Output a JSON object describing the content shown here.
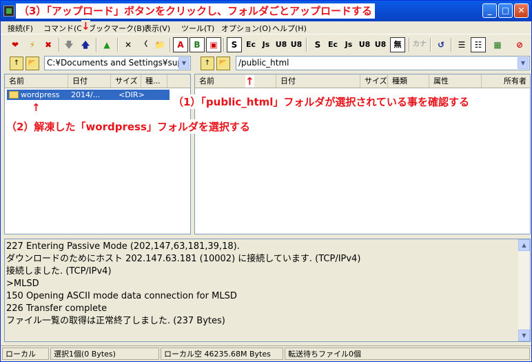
{
  "title_annotation": "（3）「アップロード」ボタンをクリックし、フォルダごとアップロードする",
  "window_buttons": {
    "minimize": "_",
    "maximize": "□",
    "close": "✕"
  },
  "menu": [
    "接続(F)",
    "コマンド(C)",
    "ブックマーク(B)",
    "表示(V)",
    "ツール(T)",
    "オプション(O)",
    "ヘルプ(H)"
  ],
  "toolbar": {
    "icons": [
      "connect-icon",
      "quick-connect-icon",
      "disconnect-icon",
      "download-icon",
      "upload-icon",
      "mirror-upload-icon",
      "delete-icon",
      "rename-icon",
      "new-folder-icon",
      "ascii-mode-icon",
      "binary-mode-icon",
      "auto-mode-icon",
      "sjis-icon",
      "euc-icon",
      "jis-icon",
      "utf8-icon",
      "utf8n-icon",
      "remote-sjis-icon",
      "remote-euc-icon",
      "remote-jis-icon",
      "remote-utf8-icon",
      "remote-utf8n-icon",
      "no-convert-icon",
      "kana-icon",
      "refresh-icon",
      "list-view-icon",
      "detail-view-icon",
      "tree-icon",
      "stop-icon"
    ],
    "labels": {
      "ascii": "A",
      "binary": "B",
      "sjis": "S",
      "euc": "Ec",
      "jis": "Js",
      "utf8": "U8",
      "utf8n": "U8",
      "none": "無",
      "kana": "カナ"
    }
  },
  "local": {
    "path": "C:¥Documents and Settings¥sup",
    "columns": [
      "名前",
      "日付",
      "サイズ",
      "種..."
    ],
    "rows": [
      {
        "name": "wordpress",
        "date": "2014/...",
        "size": "<DIR>"
      }
    ]
  },
  "remote": {
    "path": "/public_html",
    "columns": [
      "名前",
      "日付",
      "サイズ",
      "種類",
      "属性",
      "所有者"
    ]
  },
  "annotations": {
    "a1": "（1）「public_html」フォルダが選択されている事を確認する",
    "a2": "（2）解凍した「wordpress」フォルダを選択する",
    "arrow": "↑",
    "arrow_down": "↓"
  },
  "log": [
    "227 Entering Passive Mode (202,147,63,181,39,18).",
    "ダウンロードのためにホスト 202.147.63.181 (10002) に接続しています. (TCP/IPv4)",
    "接続しました. (TCP/IPv4)",
    ">MLSD",
    "150 Opening ASCII mode data connection for MLSD",
    "226 Transfer complete",
    "ファイル一覧の取得は正常終了しました. (237 Bytes)"
  ],
  "status": {
    "side": "ローカル",
    "selection": "選択1個(0 Bytes)",
    "free": "ローカル空 46235.68M Bytes",
    "queue": "転送待ちファイル0個"
  },
  "colors": {
    "annotation": "#e8141c",
    "selection": "#316ac5",
    "titlebar": "#0a5ce6"
  }
}
